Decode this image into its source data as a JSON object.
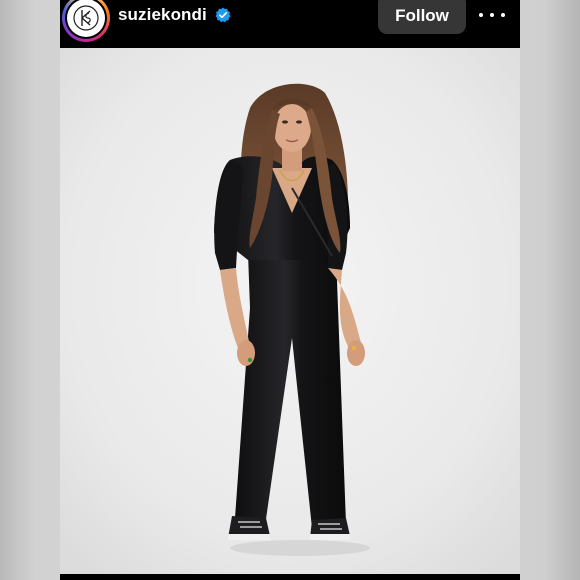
{
  "post_header": {
    "username": "suziekondi",
    "verified": true,
    "follow_label": "Follow",
    "more_icon": "more-horizontal-icon",
    "avatar_icon": "brand-logo-avatar"
  },
  "post_image": {
    "subject": "model-in-black-velvet-jumpsuit",
    "background_color": "#ebebeb"
  },
  "colors": {
    "header_bg": "#000000",
    "follow_bg": "#363636",
    "verified_blue": "#1d9bf0",
    "text": "#ffffff"
  }
}
